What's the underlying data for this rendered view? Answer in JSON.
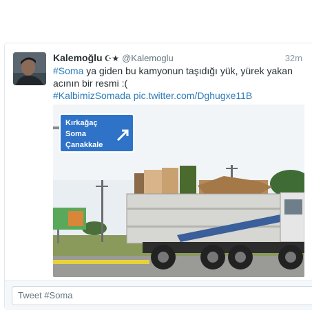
{
  "tweet": {
    "fullname": "Kalemoğlu",
    "name_symbols": "☪★",
    "username": "@Kalemoglu",
    "timestamp": "32m",
    "hashtag_start": "#Soma",
    "body": " ya giden bu kamyonun taşıdığı yük, yürek yakan acının bir resmi :(",
    "hashtag_end": "#KalbimizSomada",
    "pic_link": "pic.twitter.com/Dghugxe11B",
    "photo": {
      "sign_lines": [
        "Kırkağaç",
        "Soma",
        "Çanakkale"
      ]
    }
  },
  "compose": {
    "value": "Tweet #Soma"
  },
  "colors": {
    "link": "#2b7bb9",
    "text": "#292f33",
    "secondary": "#66757f",
    "sign_blue": "#2f73c8"
  }
}
